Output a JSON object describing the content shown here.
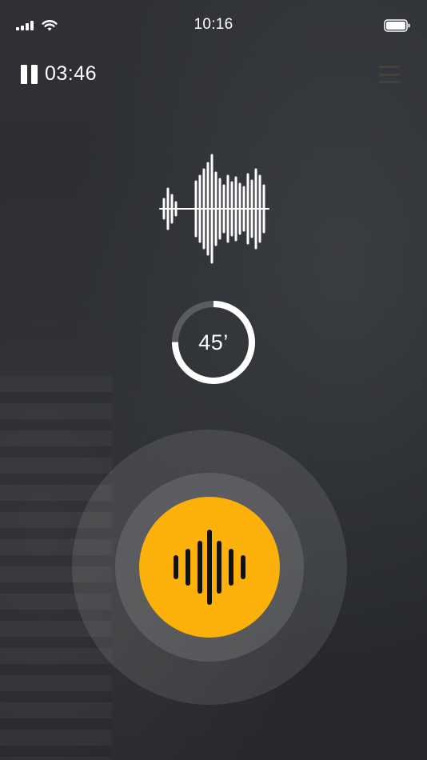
{
  "status_bar": {
    "time": "10:16",
    "signal_icon": "cellular-signal-icon",
    "wifi_icon": "wifi-icon",
    "battery_icon": "battery-icon"
  },
  "player": {
    "pause_icon": "pause-icon",
    "elapsed": "03:46",
    "menu_icon": "menu-icon"
  },
  "waveform": {
    "icon": "sound-waveform-icon",
    "color": "#ffffff"
  },
  "countdown": {
    "label": "45’",
    "progress": 0.75,
    "ring_color": "#ffffff",
    "track_color": "#5a5c60"
  },
  "record": {
    "icon": "sound-bars-icon",
    "button_color": "#fbb10a",
    "icon_color": "#111111"
  }
}
